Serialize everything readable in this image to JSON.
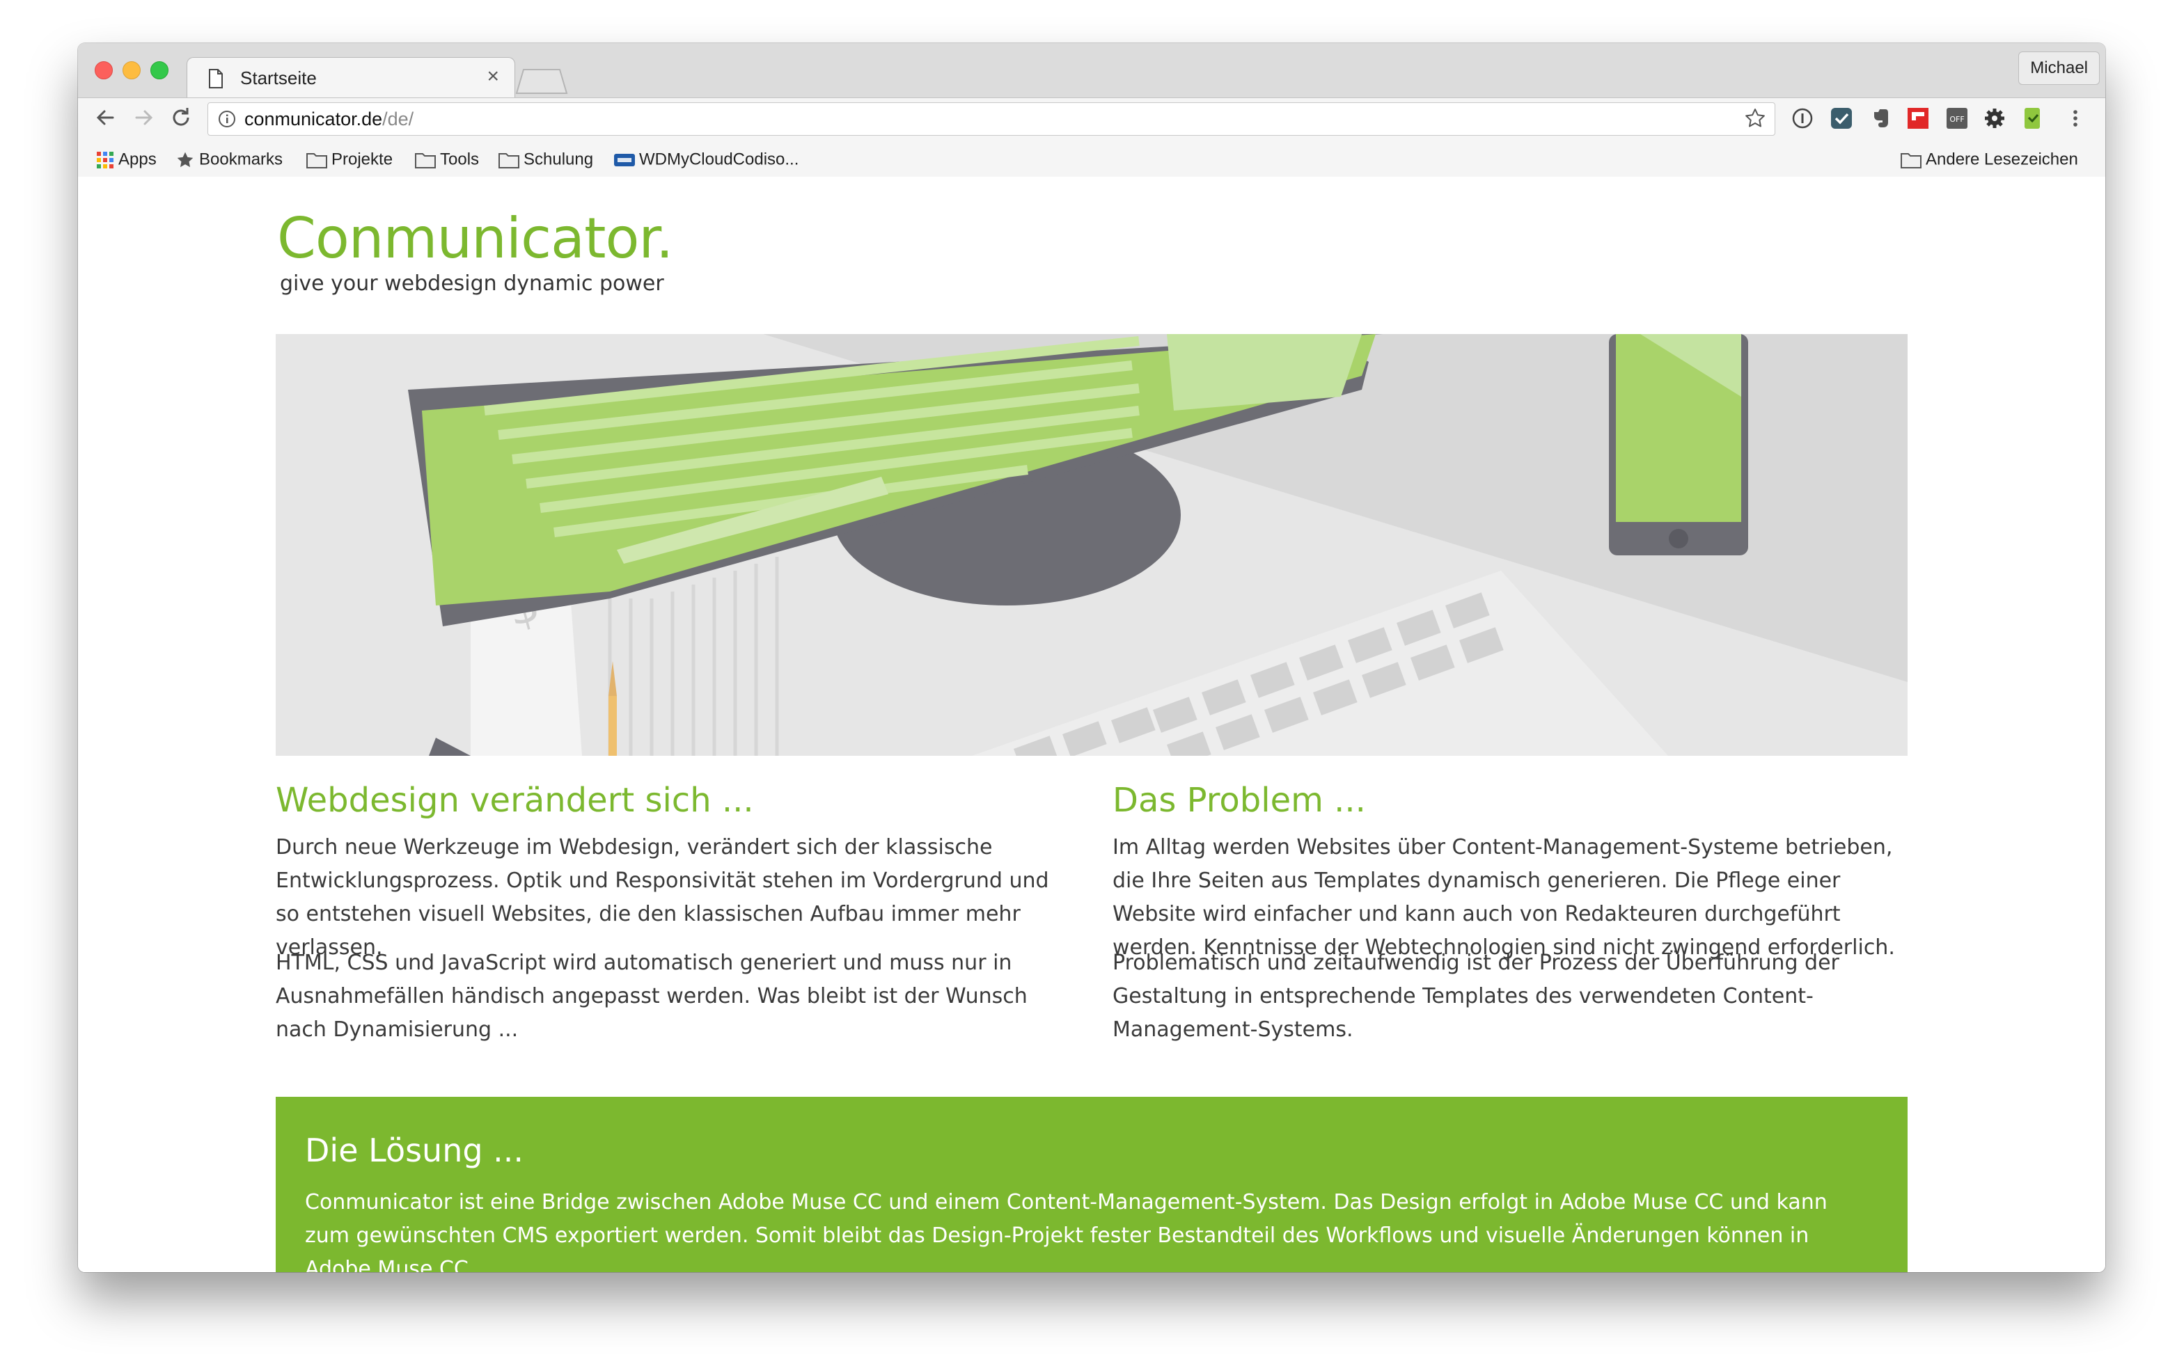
{
  "browser": {
    "tab": {
      "title": "Startseite",
      "close_glyph": "×"
    },
    "profile": "Michael",
    "address": {
      "host": "conmunicator.de",
      "path": "/de/"
    },
    "bookmarks": {
      "apps": "Apps",
      "bookmarks": "Bookmarks",
      "projekte": "Projekte",
      "tools": "Tools",
      "schulung": "Schulung",
      "wd": "WDMyCloudCodiso...",
      "andere": "Andere Lesezeichen"
    },
    "extensions": [
      "info-circle-icon",
      "checkmark-extension-icon",
      "evernote-icon",
      "flipboard-icon",
      "off-extension-icon",
      "gear-extension-icon",
      "green-extension-icon",
      "menu-dots-icon"
    ]
  },
  "page": {
    "logo": "Conmunicator.",
    "tagline": "give your webdesign dynamic power",
    "left": {
      "title": "Webdesign verändert sich ...",
      "p1": "Durch neue Werkzeuge im Webdesign, verändert sich der klassische Entwicklungsprozess. Optik und Responsivität stehen im Vordergrund und so entstehen visuell Websites, die den klassischen Aufbau immer mehr verlassen.",
      "p2": "HTML, CSS und JavaScript wird automatisch generiert und muss nur in Ausnahmefällen händisch angepasst werden. Was bleibt ist der Wunsch nach Dynamisierung ..."
    },
    "right": {
      "title": "Das Problem ...",
      "p1": "Im Alltag werden Websites über Content-Management-Systeme betrieben, die Ihre Seiten aus Templates dynamisch generieren. Die Pflege einer Website wird einfacher und kann auch von Redakteuren durchgeführt werden. Kenntnisse der Webtechnologien sind nicht zwingend erforderlich.",
      "p2": "Problematisch und zeitaufwendig ist der Prozess der Überführung der Gestaltung in entsprechende Templates des verwendeten Content-Management-Systems."
    },
    "solution": {
      "title": "Die Lösung ...",
      "text": "Conmunicator ist eine Bridge zwischen Adobe Muse CC und einem Content-Management-System. Das Design erfolgt in Adobe Muse CC und kann zum gewünschten CMS exportiert werden. Somit bleibt das Design-Projekt fester Bestandteil des Workflows und visuelle Änderungen können in Adobe Muse CC"
    }
  },
  "colors": {
    "brand_green": "#7cb82f",
    "text": "#3a3a3a"
  }
}
